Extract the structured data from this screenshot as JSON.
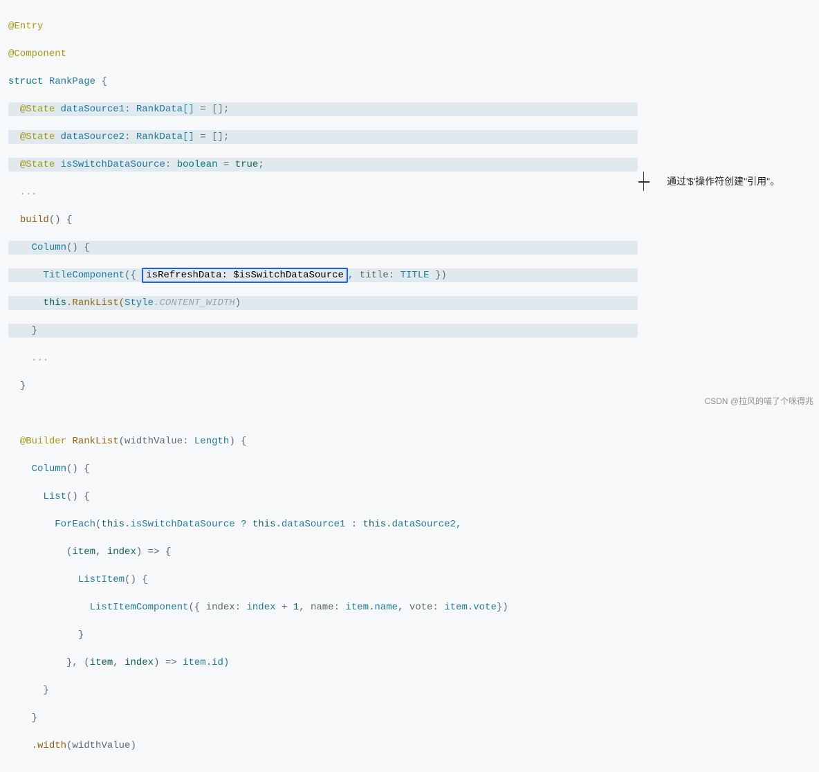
{
  "code": {
    "l1": "@Entry",
    "l2": "@Component",
    "l3_a": "struct",
    "l3_b": "RankPage",
    "l3_c": "{",
    "l4_a": "@State",
    "l4_b": "dataSource1",
    "l4_c": "RankData[]",
    "l4_d": "= [];",
    "l5_a": "@State",
    "l5_b": "dataSource2",
    "l5_c": "RankData[]",
    "l5_d": "= [];",
    "l6_a": "@State",
    "l6_b": "isSwitchDataSource",
    "l6_c": "boolean",
    "l6_d": "true",
    "l7": "...",
    "l8_a": "build",
    "l8_b": "() {",
    "l9_a": "Column",
    "l9_b": "()",
    "l9_c": "{",
    "l10_a": "TitleComponent",
    "l10_b": "({",
    "l10_box": "isRefreshData: $isSwitchDataSource",
    "l10_c": ",",
    "l10_d": "title",
    "l10_e": "TITLE",
    "l10_f": "})",
    "l11_a": "this",
    "l11_b": ".RankList(",
    "l11_c": "Style",
    "l11_d": ".CONTENT_WIDTH",
    "l11_e": ")",
    "l12": "}",
    "l13": "...",
    "l14": "}",
    "l16_a": "@Builder",
    "l16_b": "RankList",
    "l16_c": "(widthValue:",
    "l16_d": "Length",
    "l16_e": ") {",
    "l17_a": "Column",
    "l17_b": "()",
    "l17_c": "{",
    "l18_a": "List",
    "l18_b": "()",
    "l18_c": "{",
    "l19_a": "ForEach",
    "l19_b": "(",
    "l19_c": "this",
    "l19_d": ".isSwitchDataSource ?",
    "l19_e": "this",
    "l19_f": ".dataSource1 :",
    "l19_g": "this",
    "l19_h": ".dataSource2,",
    "l20_a": "(",
    "l20_b": "item",
    "l20_c": ",",
    "l20_d": "index",
    "l20_e": ") =>",
    "l20_f": "{",
    "l21_a": "ListItem",
    "l21_b": "()",
    "l21_c": "{",
    "l22_a": "ListItemComponent",
    "l22_b": "({",
    "l22_c": "index",
    "l22_d": ":",
    "l22_e": "index",
    "l22_f": "+",
    "l22_g": "1",
    "l22_h": ",",
    "l22_i": "name",
    "l22_j": ":",
    "l22_k": "item",
    "l22_l": ".name,",
    "l22_m": "vote",
    "l22_n": ":",
    "l22_o": "item",
    "l22_p": ".vote",
    "l22_q": "})",
    "l23": "}",
    "l24_a": "},",
    "l24_b": "(",
    "l24_c": "item",
    "l24_d": ",",
    "l24_e": "index",
    "l24_f": ") =>",
    "l24_g": "item",
    "l24_h": ".id)",
    "l25": "}",
    "l26": "}",
    "l27_a": ".",
    "l27_b": "width",
    "l27_c": "(widthValue)",
    "l28": ""
  },
  "annotation": "通过'$'操作符创建\"引用\"。",
  "watermark": "CSDN @拉风的喵了个咪得兆"
}
